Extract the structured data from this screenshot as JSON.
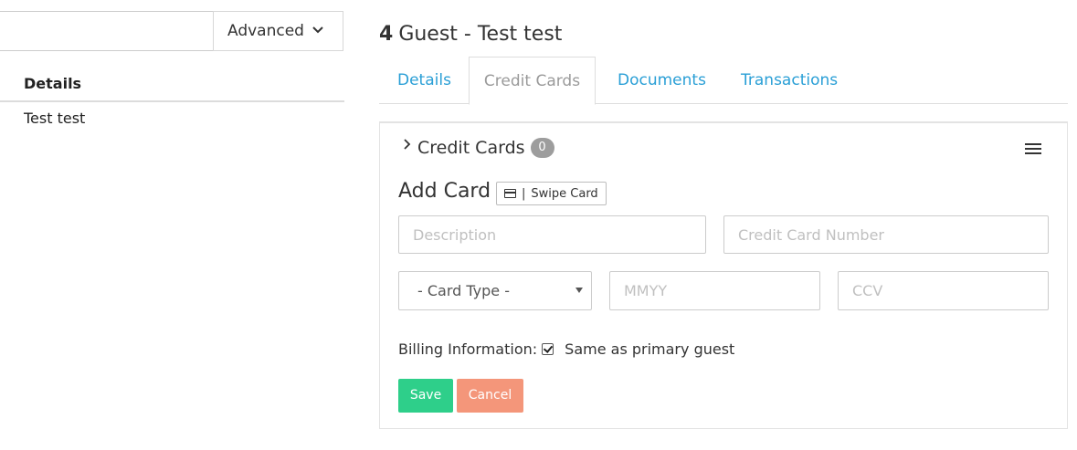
{
  "left": {
    "search_value": "",
    "advanced_label": "Advanced",
    "details_heading": "Details",
    "details_value": "Test test"
  },
  "guest": {
    "number": "4",
    "title": "Guest - Test test"
  },
  "tabs": [
    {
      "label": "Details",
      "active": false
    },
    {
      "label": "Credit Cards",
      "active": true
    },
    {
      "label": "Documents",
      "active": false
    },
    {
      "label": "Transactions",
      "active": false
    }
  ],
  "credit_cards": {
    "heading": "Credit Cards",
    "count": "0",
    "add_card_label": "Add Card",
    "swipe_separator": "|",
    "swipe_label": "Swipe Card",
    "description_placeholder": "Description",
    "number_placeholder": "Credit Card Number",
    "card_type_value": "- Card Type -",
    "expiry_placeholder": "MMYY",
    "ccv_placeholder": "CCV",
    "billing_label": "Billing Information:",
    "same_as_primary_label": "Same as primary guest",
    "same_as_primary_checked": true,
    "save_label": "Save",
    "cancel_label": "Cancel"
  },
  "colors": {
    "link": "#2a9fd6",
    "save": "#2ecf8a",
    "cancel": "#f4967a",
    "badge": "#9d9d9d"
  }
}
